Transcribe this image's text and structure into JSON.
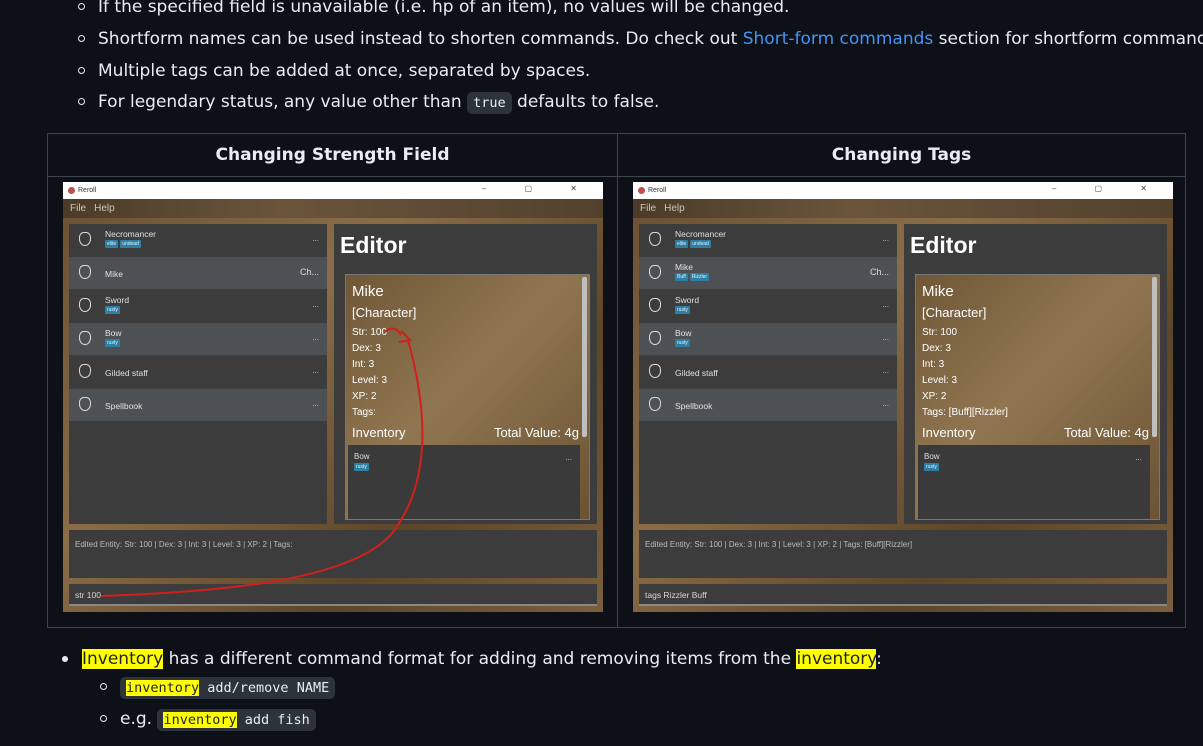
{
  "bullets_top": [
    {
      "text": "If the specified field is unavailable (i.e. hp of an item), no values will be changed."
    },
    {
      "pre": "Shortform names can be used instead to shorten commands. Do check out ",
      "link": "Short-form commands",
      "post": " section for shortform commands!"
    },
    {
      "text": "Multiple tags can be added at once, separated by spaces."
    },
    {
      "pre": "For legendary status, any value other than ",
      "code": "true",
      "post": " defaults to false."
    }
  ],
  "table": {
    "headers": [
      "Changing Strength Field",
      "Changing Tags"
    ]
  },
  "app": {
    "title": "Reroll",
    "menu": [
      "File",
      "Help"
    ],
    "window_controls": "–  ▢  ✕",
    "list_left": [
      {
        "name": "Necromancer",
        "tags": [
          "elite",
          "undead"
        ],
        "right": "..."
      },
      {
        "name": "Mike",
        "tags": [],
        "right": "Ch..."
      },
      {
        "name": "Sword",
        "tags": [
          "rusty"
        ],
        "right": "..."
      },
      {
        "name": "Bow",
        "tags": [
          "rusty"
        ],
        "right": "..."
      },
      {
        "name": "Gilded staff",
        "tags": [],
        "right": "..."
      },
      {
        "name": "Spellbook",
        "tags": [],
        "right": "..."
      }
    ],
    "list_right": [
      {
        "name": "Necromancer",
        "tags": [
          "elite",
          "undead"
        ],
        "right": "..."
      },
      {
        "name": "Mike",
        "tags": [
          "Buff",
          "Rizzler"
        ],
        "right": "Ch..."
      },
      {
        "name": "Sword",
        "tags": [
          "rusty"
        ],
        "right": "..."
      },
      {
        "name": "Bow",
        "tags": [
          "rusty"
        ],
        "right": "..."
      },
      {
        "name": "Gilded staff",
        "tags": [],
        "right": "..."
      },
      {
        "name": "Spellbook",
        "tags": [],
        "right": "..."
      }
    ],
    "editor_title": "Editor",
    "card_left": {
      "name": "Mike",
      "type": "[Character]",
      "stats": [
        "Str: 100",
        "Dex: 3",
        "Int: 3",
        "Level: 3",
        "XP: 2",
        "Tags:"
      ],
      "inventory_label": "Inventory",
      "total": "Total Value: 4g",
      "inv_item": "Bow",
      "inv_tag": "rusty",
      "inv_dots": "..."
    },
    "card_right": {
      "name": "Mike",
      "type": "[Character]",
      "stats": [
        "Str: 100",
        "Dex: 3",
        "Int: 3",
        "Level: 3",
        "XP: 2",
        "Tags: [Buff][Rizzler]"
      ],
      "inventory_label": "Inventory",
      "total": "Total Value: 4g",
      "inv_item": "Bow",
      "inv_tag": "rusty",
      "inv_dots": "..."
    },
    "result_left": "Edited Entity: Str: 100 | Dex: 3 | Int: 3 | Level: 3 | XP: 2 | Tags:",
    "result_right": "Edited Entity: Str: 100 | Dex: 3 | Int: 3 | Level: 3 | XP: 2 | Tags: [Buff][Rizzler]",
    "cmd_left": "str 100",
    "cmd_right": "tags Rizzler Buff"
  },
  "bottom": {
    "bullet": {
      "hl1": "Inventory",
      "mid": " has a different command format for adding and removing items from the ",
      "hl2": "inventory",
      "end": ":"
    },
    "sub1": {
      "hl": "inventory",
      "rest": " add/remove NAME"
    },
    "sub2": {
      "pre": "e.g. ",
      "hl": "inventory",
      "rest": " add fish"
    }
  },
  "colors": {
    "link": "#4493f8",
    "highlight": "#ffff00",
    "annotation_arrow": "#d0201c"
  }
}
